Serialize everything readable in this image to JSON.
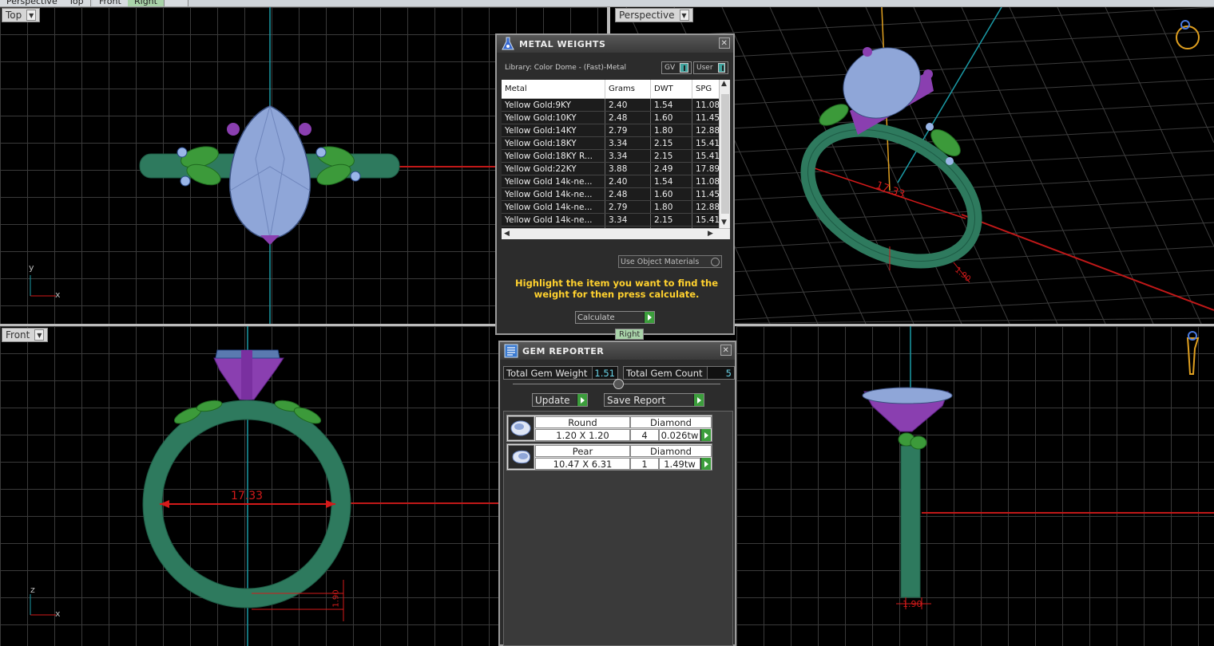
{
  "top_tabs": [
    {
      "label": "Perspective",
      "active": false
    },
    {
      "label": "Top",
      "active": false
    },
    {
      "label": "Front",
      "active": false
    },
    {
      "label": "Right",
      "active": true
    }
  ],
  "viewports": {
    "top": {
      "label": "Top"
    },
    "perspective": {
      "label": "Perspective"
    },
    "front": {
      "label": "Front"
    },
    "right": {
      "label": "Right"
    }
  },
  "dimensions": {
    "ring_size": "17.33",
    "front_small": "1.90",
    "right_small": "1.90",
    "persp_small": "1.90"
  },
  "axes": {
    "x": "x",
    "y": "y",
    "z": "z"
  },
  "metal_weights": {
    "title": "METAL WEIGHTS",
    "library": "Library: Color Dome - (Fast)-Metal",
    "toggle_gv": "GV",
    "toggle_user": "User",
    "columns": [
      "Metal",
      "Grams",
      "DWT",
      "SPG"
    ],
    "rows": [
      {
        "metal": "Yellow Gold:9KY",
        "grams": "2.40",
        "dwt": "1.54",
        "spg": "11.08"
      },
      {
        "metal": "Yellow Gold:10KY",
        "grams": "2.48",
        "dwt": "1.60",
        "spg": "11.45"
      },
      {
        "metal": "Yellow Gold:14KY",
        "grams": "2.79",
        "dwt": "1.80",
        "spg": "12.88"
      },
      {
        "metal": "Yellow Gold:18KY",
        "grams": "3.34",
        "dwt": "2.15",
        "spg": "15.41"
      },
      {
        "metal": "Yellow Gold:18KY R...",
        "grams": "3.34",
        "dwt": "2.15",
        "spg": "15.41"
      },
      {
        "metal": "Yellow Gold:22KY",
        "grams": "3.88",
        "dwt": "2.49",
        "spg": "17.89"
      },
      {
        "metal": "Yellow Gold 14k-ne...",
        "grams": "2.40",
        "dwt": "1.54",
        "spg": "11.08"
      },
      {
        "metal": "Yellow Gold 14k-ne...",
        "grams": "2.48",
        "dwt": "1.60",
        "spg": "11.45"
      },
      {
        "metal": "Yellow Gold 14k-ne...",
        "grams": "2.79",
        "dwt": "1.80",
        "spg": "12.88"
      },
      {
        "metal": "Yellow Gold 14k-ne...",
        "grams": "3.34",
        "dwt": "2.15",
        "spg": "15.41"
      },
      {
        "metal": "Yellow Gold 14k-ne...",
        "grams": "3.34",
        "dwt": "2.15",
        "spg": "15.41"
      }
    ],
    "use_object_materials": "Use Object Materials",
    "hint": "Highlight the item you want to find the weight for then press calculate.",
    "calculate_label": "Calculate"
  },
  "gem_reporter": {
    "title": "GEM REPORTER",
    "total_weight_label": "Total Gem Weight",
    "total_weight_value": "1.51",
    "total_count_label": "Total Gem Count",
    "total_count_value": "5",
    "update_label": "Update",
    "save_report_label": "Save Report",
    "gems": [
      {
        "shape": "Round",
        "material": "Diamond",
        "size": "1.20 X 1.20",
        "count": "4",
        "weight": "0.026tw"
      },
      {
        "shape": "Pear",
        "material": "Diamond",
        "size": "10.47 X 6.31",
        "count": "1",
        "weight": "1.49tw"
      }
    ]
  },
  "colors": {
    "band": "#2e7a5e",
    "gem": "#8fa6d8",
    "prong": "#8a3fb0",
    "leaf": "#3c9a3a",
    "dimension": "#d41a1a",
    "axis_line": "#1a9aa6",
    "hint": "#ffd12e"
  }
}
